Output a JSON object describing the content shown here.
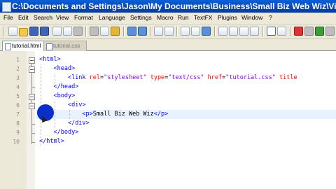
{
  "window": {
    "title": "C:\\Documents and Settings\\Jason\\My Documents\\Business\\Small Biz Web Wiz\\Videos\\CSS Tutorial\\tutorial.html"
  },
  "menu": [
    "File",
    "Edit",
    "Search",
    "View",
    "Format",
    "Language",
    "Settings",
    "Macro",
    "Run",
    "TextFX",
    "Plugins",
    "Window",
    "?"
  ],
  "toolbar": {
    "icons": [
      "new-file-icon",
      "open-file-icon",
      "save-icon",
      "save-all-icon",
      "close-icon",
      "close-all-icon",
      "print-icon",
      "cut-icon",
      "copy-icon",
      "paste-icon",
      "undo-icon",
      "redo-icon",
      "find-icon",
      "replace-icon",
      "zoom-in-icon",
      "zoom-out-icon",
      "sync-scroll-icon",
      "word-wrap-icon",
      "show-all-chars-icon",
      "indent-guide-icon",
      "record-macro-icon",
      "stop-macro-icon",
      "play-macro-icon"
    ]
  },
  "tabs": [
    {
      "label": "tutorial.html",
      "active": true
    },
    {
      "label": "tutorial.css",
      "active": false
    }
  ],
  "editor": {
    "line_numbers": [
      "1",
      "2",
      "3",
      "4",
      "5",
      "6",
      "7",
      "8",
      "9",
      "10"
    ],
    "current_line": 7,
    "lines": [
      {
        "indent": "",
        "segments": [
          {
            "t": "tag",
            "v": "<html>"
          }
        ]
      },
      {
        "indent": "    ",
        "segments": [
          {
            "t": "tag",
            "v": "<head>"
          }
        ]
      },
      {
        "indent": "        ",
        "segments": [
          {
            "t": "tag",
            "v": "<link "
          },
          {
            "t": "attr",
            "v": "rel"
          },
          {
            "t": "txt",
            "v": "="
          },
          {
            "t": "val",
            "v": "\"stylesheet\""
          },
          {
            "t": "txt",
            "v": " "
          },
          {
            "t": "attr",
            "v": "type"
          },
          {
            "t": "txt",
            "v": "="
          },
          {
            "t": "val",
            "v": "\"text/css\""
          },
          {
            "t": "txt",
            "v": " "
          },
          {
            "t": "attr",
            "v": "href"
          },
          {
            "t": "txt",
            "v": "="
          },
          {
            "t": "val",
            "v": "\"tutorial.css\""
          },
          {
            "t": "txt",
            "v": " "
          },
          {
            "t": "attr",
            "v": "title"
          }
        ]
      },
      {
        "indent": "    ",
        "segments": [
          {
            "t": "tag",
            "v": "</head>"
          }
        ]
      },
      {
        "indent": "    ",
        "segments": [
          {
            "t": "tag",
            "v": "<body>"
          }
        ]
      },
      {
        "indent": "        ",
        "segments": [
          {
            "t": "tag",
            "v": "<div>"
          }
        ]
      },
      {
        "indent": "            ",
        "segments": [
          {
            "t": "tag",
            "v": "<p>"
          },
          {
            "t": "txt",
            "v": "Small Biz Web Wiz"
          },
          {
            "t": "tag",
            "v": "</p>"
          }
        ]
      },
      {
        "indent": "        ",
        "segments": [
          {
            "t": "tag",
            "v": "</div>"
          }
        ]
      },
      {
        "indent": "    ",
        "segments": [
          {
            "t": "tag",
            "v": "</body>"
          }
        ]
      },
      {
        "indent": "",
        "segments": [
          {
            "t": "tag",
            "v": "</html>"
          }
        ]
      }
    ]
  },
  "colors": {
    "tag": "#0000ff",
    "attribute": "#ff0000",
    "value": "#8000ff",
    "titlebar": "#0847b8",
    "current_line": "#e8f2ff"
  }
}
